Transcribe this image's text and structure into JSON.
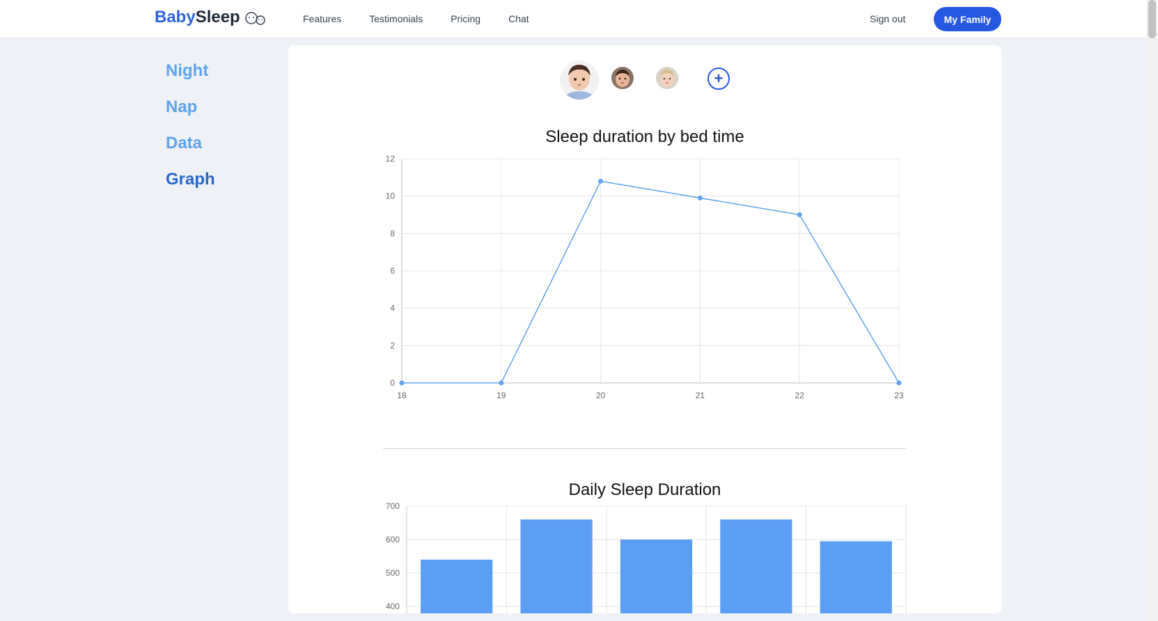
{
  "brand": {
    "part1": "Baby",
    "part2": "Sleep"
  },
  "nav": [
    "Features",
    "Testimonials",
    "Pricing",
    "Chat"
  ],
  "header": {
    "sign_out": "Sign out",
    "family_button": "My Family"
  },
  "sidebar": [
    {
      "label": "Night",
      "active": false
    },
    {
      "label": "Nap",
      "active": false
    },
    {
      "label": "Data",
      "active": false
    },
    {
      "label": "Graph",
      "active": true
    }
  ],
  "add_symbol": "+",
  "colors": {
    "accent": "#2558e0",
    "series": "#5ea3ec",
    "bar": "#5b9ff5"
  },
  "chart_data": [
    {
      "type": "line",
      "title": "Sleep duration by bed time",
      "x": [
        18,
        19,
        20,
        21,
        22,
        23
      ],
      "values": [
        0,
        0,
        10.8,
        9.9,
        9.0,
        0
      ],
      "ylim": [
        0,
        12
      ],
      "yticks": [
        0,
        2,
        4,
        6,
        8,
        10,
        12
      ],
      "grid": true
    },
    {
      "type": "bar",
      "title": "Daily Sleep Duration",
      "values": [
        540,
        660,
        600,
        660,
        595
      ],
      "ylim": [
        400,
        700
      ],
      "yticks": [
        400,
        500,
        600,
        700
      ],
      "grid": true
    }
  ]
}
